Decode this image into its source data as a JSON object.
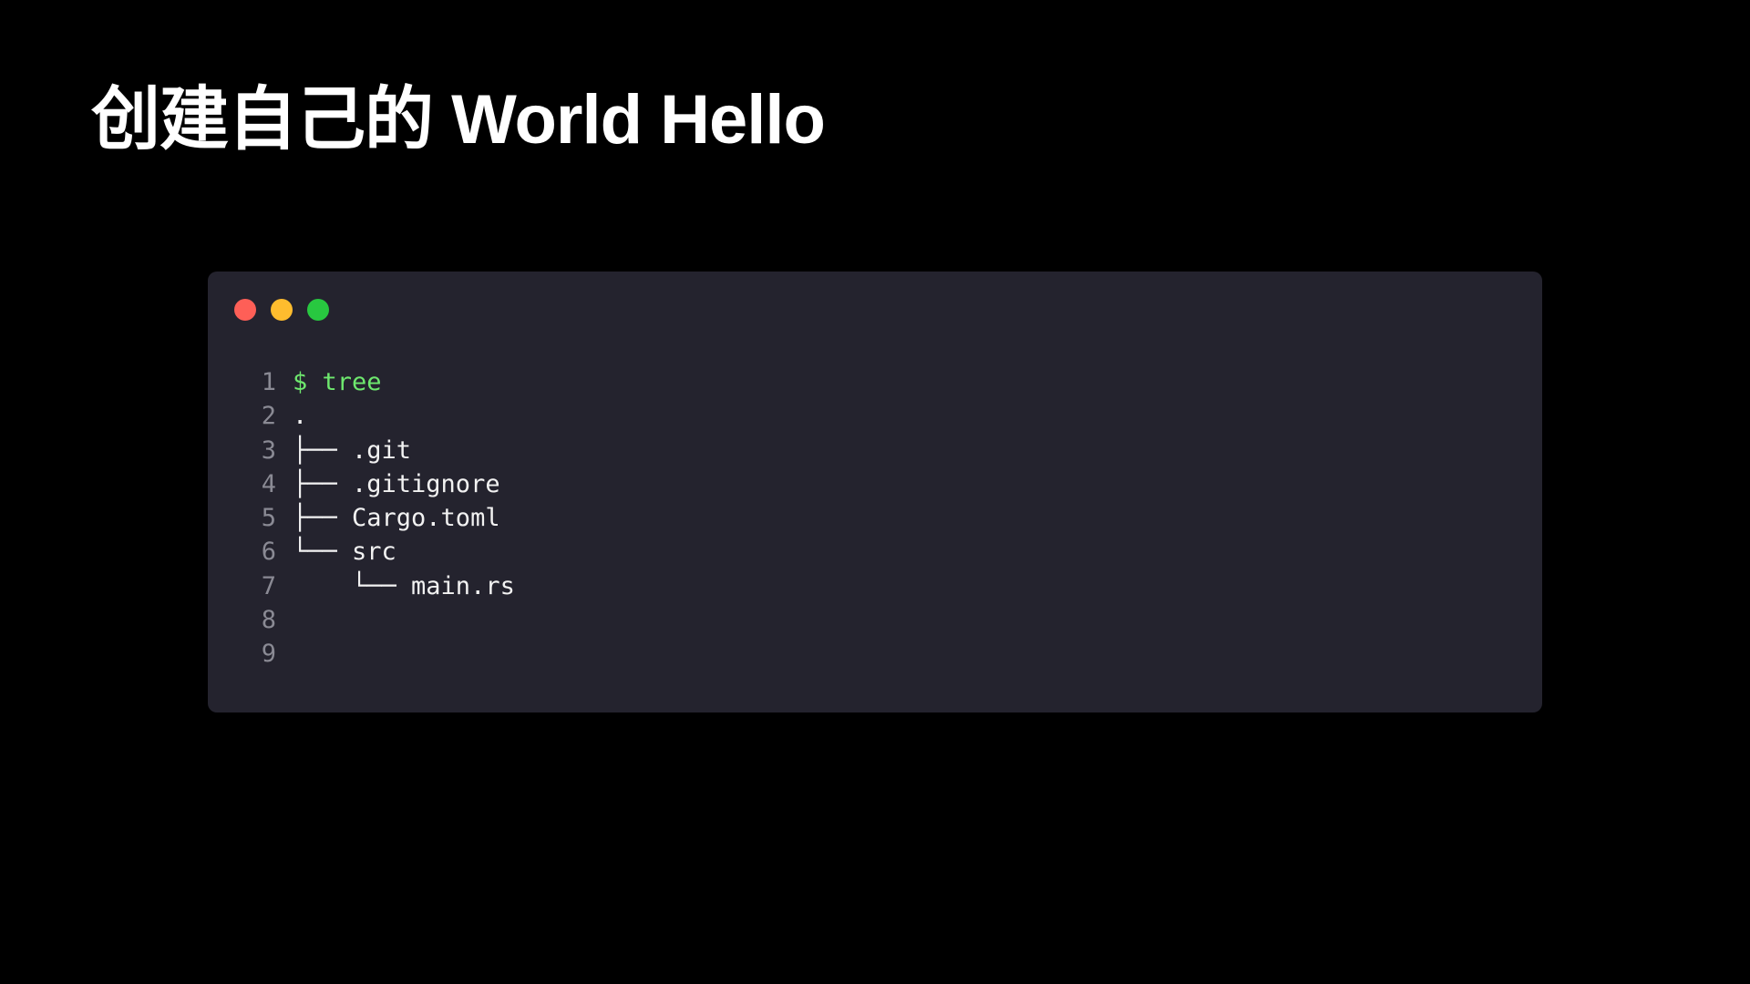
{
  "slide": {
    "title": "创建自己的 World Hello"
  },
  "terminal": {
    "window_controls": [
      {
        "name": "close-dot",
        "color": "#fe5f57"
      },
      {
        "name": "minimize-dot",
        "color": "#febc2e"
      },
      {
        "name": "maximize-dot",
        "color": "#28c840"
      }
    ],
    "lines": [
      {
        "number": "1",
        "text": "$ tree",
        "kind": "command"
      },
      {
        "number": "2",
        "text": ".",
        "kind": "output"
      },
      {
        "number": "3",
        "text": "├── .git",
        "kind": "output"
      },
      {
        "number": "4",
        "text": "├── .gitignore",
        "kind": "output"
      },
      {
        "number": "5",
        "text": "├── Cargo.toml",
        "kind": "output"
      },
      {
        "number": "6",
        "text": "└── src",
        "kind": "output"
      },
      {
        "number": "7",
        "text": "    └── main.rs",
        "kind": "output"
      },
      {
        "number": "8",
        "text": "",
        "kind": "output"
      },
      {
        "number": "9",
        "text": "",
        "kind": "output"
      }
    ]
  },
  "colors": {
    "background": "#000000",
    "panel": "#24232e",
    "command": "#6ee86e",
    "text": "#f2f2f2",
    "line_number": "#8a8a94"
  }
}
